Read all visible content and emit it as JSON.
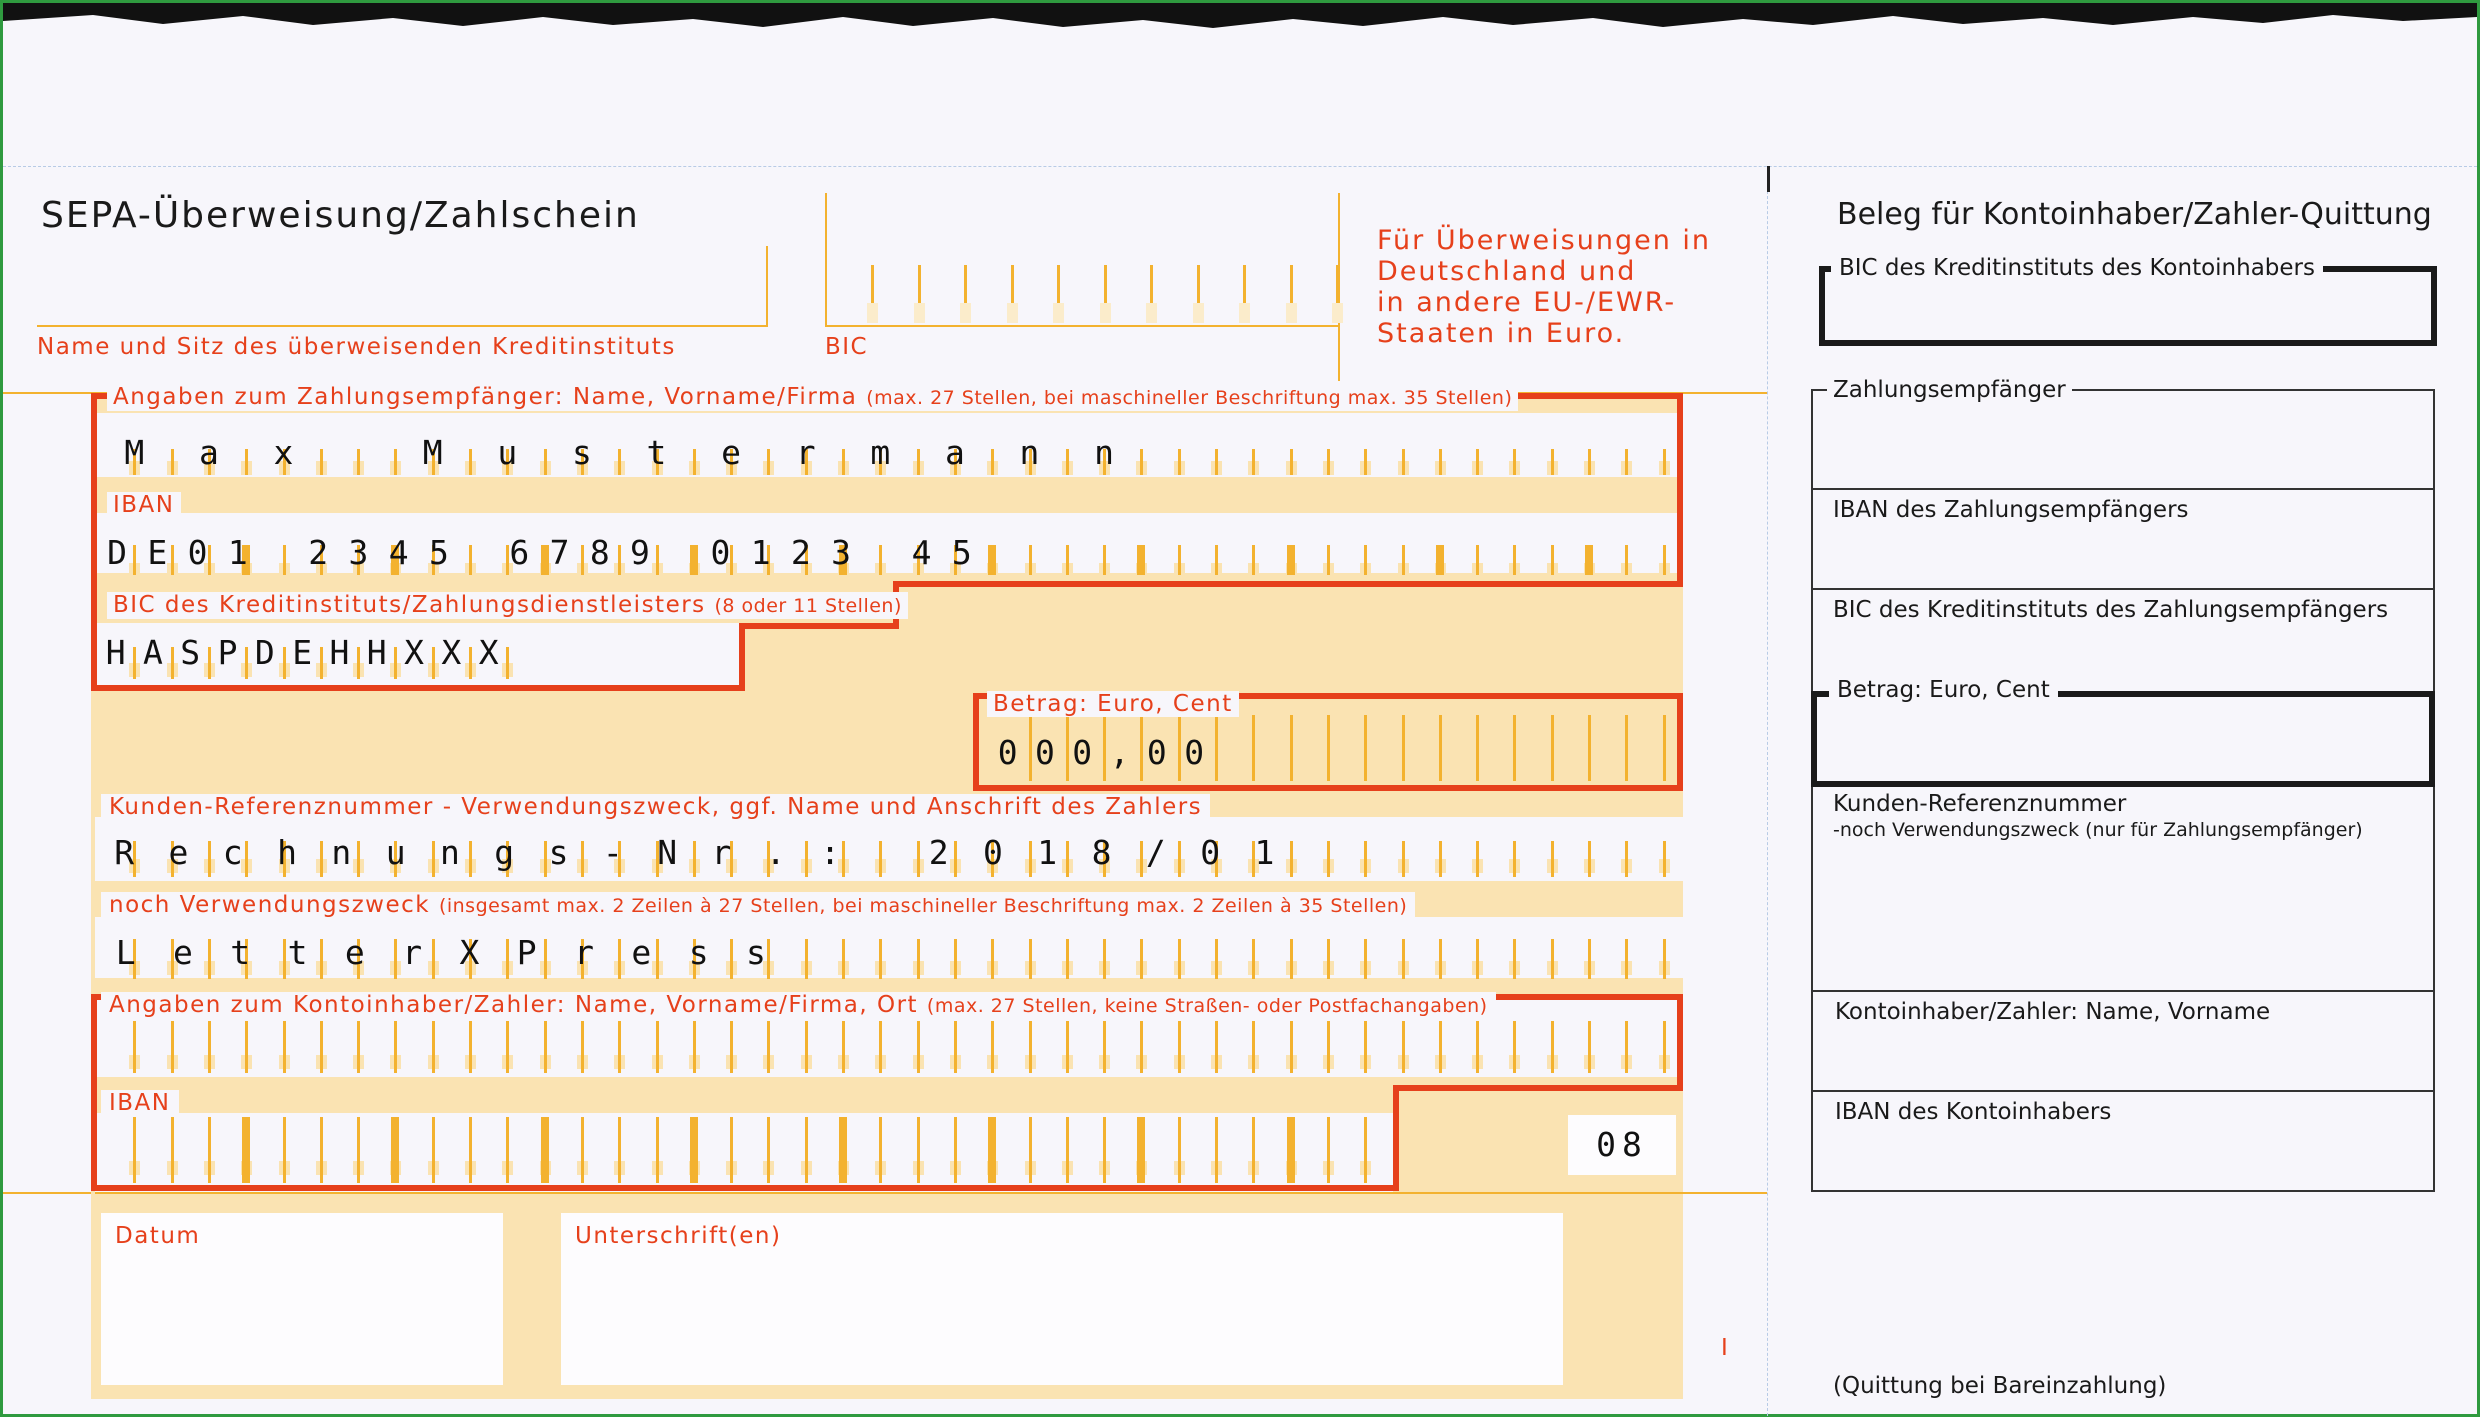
{
  "form": {
    "title": "SEPA-Überweisung/Zahlschein",
    "bank_name_label": "Name und Sitz des überweisenden Kreditinstituts",
    "bic_label": "BIC",
    "notice_lines": [
      "Für Überweisungen in",
      "Deutschland und",
      "in andere EU-/EWR-",
      "Staaten in Euro."
    ],
    "payee_label": "Angaben zum Zahlungsempfänger: Name, Vorname/Firma",
    "payee_hint": "(max. 27 Stellen, bei maschineller Beschriftung max. 35 Stellen)",
    "payee_value": "Max Mustermann",
    "iban_label": "IBAN",
    "iban_value": "DE01 2345 6789 0123 45",
    "bic_bank_label": "BIC des Kreditinstituts/Zahlungsdienstleisters",
    "bic_bank_hint": "(8 oder 11 Stellen)",
    "bic_value": "HASPDEHHXXX",
    "amount_label": "Betrag: Euro, Cent",
    "amount_value": "000,00",
    "reference_label": "Kunden-Referenznummer - Verwendungszweck, ggf. Name und Anschrift des Zahlers",
    "reference_value": "Rechnungs-Nr.: 2018/01",
    "purpose_label": "noch Verwendungszweck",
    "purpose_hint": "(insgesamt max. 2 Zeilen à 27 Stellen, bei maschineller Beschriftung max. 2 Zeilen à 35 Stellen)",
    "purpose_value": "LetterXPress",
    "payer_label": "Angaben zum Kontoinhaber/Zahler: Name, Vorname/Firma, Ort",
    "payer_hint": "(max. 27 Stellen, keine Straßen- oder Postfachangaben)",
    "payer_iban_label": "IBAN",
    "code_value": "08",
    "date_label": "Datum",
    "signature_label": "Unterschrift(en)",
    "edge_mark": "I"
  },
  "receipt": {
    "title": "Beleg für Kontoinhaber/Zahler-Quittung",
    "bic_account_holder": "BIC des Kreditinstituts des Kontoinhabers",
    "payee": "Zahlungsempfänger",
    "payee_iban": "IBAN des Zahlungsempfängers",
    "payee_bic": "BIC des Kreditinstituts des Zahlungsempfängers",
    "amount": "Betrag: Euro, Cent",
    "reference": "Kunden-Referenznummer",
    "reference_note": "-noch Verwendungszweck (nur für Zahlungsempfänger)",
    "holder_name": "Kontoinhaber/Zahler: Name, Vorname",
    "holder_iban": "IBAN des Kontoinhabers",
    "cash_note": "(Quittung bei Bareinzahlung)"
  },
  "colors": {
    "accent_red": "#e6401b",
    "field_beige": "#fae3b2",
    "tick_yellow": "#f3b22f",
    "paper": "#f7f6fb"
  }
}
